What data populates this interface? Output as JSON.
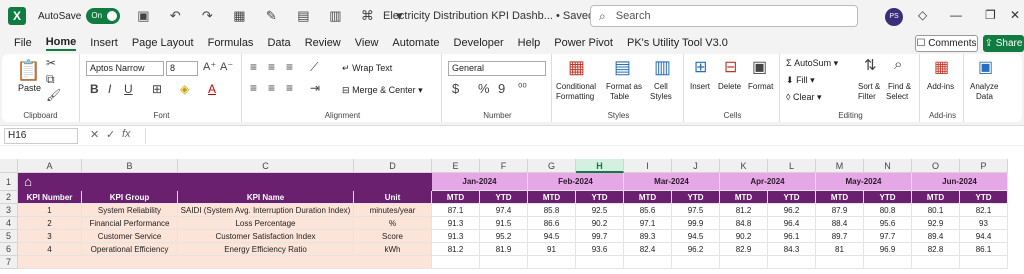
{
  "titlebar": {
    "app_letter": "X",
    "autosave_label": "AutoSave",
    "autosave_state": "On",
    "doc_title": "Electricity Distribution KPI Dashb...",
    "saved_label": "Saved",
    "search_placeholder": "Search",
    "avatar_initials": "PS"
  },
  "menu": [
    "File",
    "Home",
    "Insert",
    "Page Layout",
    "Formulas",
    "Data",
    "Review",
    "View",
    "Automate",
    "Developer",
    "Help",
    "Power Pivot",
    "PK's Utility Tool V3.0"
  ],
  "actions": {
    "comments": "Comments",
    "share": "Share"
  },
  "ribbon": {
    "clipboard": {
      "paste": "Paste",
      "label": "Clipboard"
    },
    "font": {
      "name": "Aptos Narrow",
      "size": "8",
      "label": "Font",
      "bold": "B",
      "italic": "I",
      "underline": "U",
      "font_color_letter": "A"
    },
    "alignment": {
      "wrap": "Wrap Text",
      "merge": "Merge & Center",
      "label": "Alignment"
    },
    "number": {
      "format": "General",
      "label": "Number",
      "currency": "$",
      "percent": "%",
      "comma": "9"
    },
    "styles": {
      "conditional": "Conditional",
      "conditional2": "Formatting",
      "format_table": "Format as",
      "format_table2": "Table",
      "cell_styles": "Cell",
      "cell_styles2": "Styles",
      "label": "Styles"
    },
    "cells": {
      "insert": "Insert",
      "delete": "Delete",
      "format": "Format",
      "label": "Cells"
    },
    "editing": {
      "autosum": "AutoSum",
      "fill": "Fill",
      "clear": "Clear",
      "sort": "Sort &",
      "sort2": "Filter",
      "find": "Find &",
      "find2": "Select",
      "label": "Editing"
    },
    "addins": {
      "addins": "Add-ins",
      "label": "Add-ins"
    },
    "analyze": {
      "label1": "Analyze",
      "label2": "Data"
    }
  },
  "formula_bar": {
    "name_box": "H16",
    "fx": "fx",
    "value": ""
  },
  "columns": [
    "A",
    "B",
    "C",
    "D",
    "E",
    "F",
    "G",
    "H",
    "I",
    "J",
    "K",
    "L",
    "M",
    "N",
    "O",
    "P"
  ],
  "rows": [
    "1",
    "2",
    "3",
    "4",
    "5",
    "6",
    "7"
  ],
  "months": [
    "Jan-2024",
    "Feb-2024",
    "Mar-2024",
    "Apr-2024",
    "May-2024",
    "Jun-2024"
  ],
  "headers": {
    "kpi_number": "KPI Number",
    "kpi_group": "KPI Group",
    "kpi_name": "KPI Name",
    "unit": "Unit",
    "mtd": "MTD",
    "ytd": "YTD"
  },
  "table_rows": [
    {
      "num": "1",
      "group": "System Reliability",
      "name": "SAIDI (System Avg. Interruption Duration Index)",
      "unit": "minutes/year",
      "vals": [
        "87.1",
        "97.4",
        "85.8",
        "92.5",
        "85.6",
        "97.5",
        "81.2",
        "96.2",
        "87.9",
        "80.8",
        "80.1",
        "82.1"
      ]
    },
    {
      "num": "2",
      "group": "Financial Performance",
      "name": "Loss Percentage",
      "unit": "%",
      "vals": [
        "91.3",
        "91.5",
        "86.6",
        "90.2",
        "97.1",
        "99.9",
        "84.8",
        "96.4",
        "88.4",
        "95.6",
        "92.9",
        "93"
      ]
    },
    {
      "num": "3",
      "group": "Customer Service",
      "name": "Customer Satisfaction Index",
      "unit": "Score",
      "vals": [
        "91.3",
        "95.2",
        "94.5",
        "99.7",
        "89.3",
        "94.5",
        "90.2",
        "96.1",
        "89.7",
        "97.7",
        "89.4",
        "94.4"
      ]
    },
    {
      "num": "4",
      "group": "Operational Efficiency",
      "name": "Energy Efficiency Ratio",
      "unit": "kWh",
      "vals": [
        "81.2",
        "81.9",
        "91",
        "93.6",
        "82.4",
        "96.2",
        "82.9",
        "84.3",
        "81",
        "96.9",
        "82.8",
        "86.1"
      ]
    }
  ]
}
